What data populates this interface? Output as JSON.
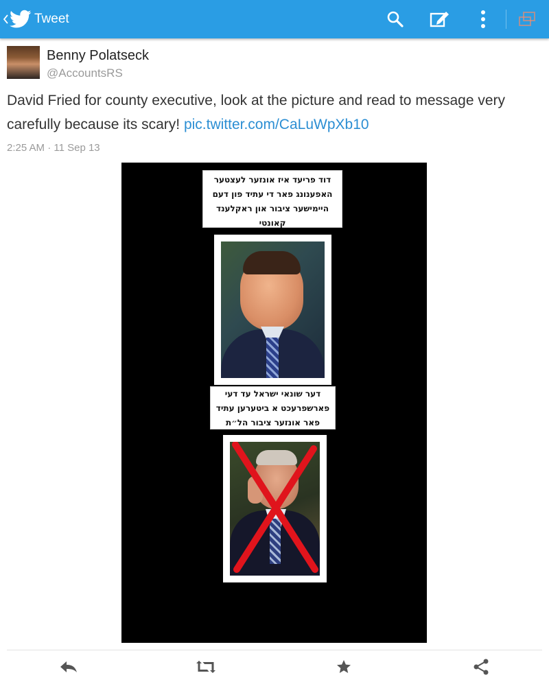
{
  "header": {
    "title": "Tweet",
    "icons": [
      "back-chevron-icon",
      "twitter-bird-icon",
      "search-icon",
      "compose-icon",
      "overflow-menu-icon",
      "recent-apps-icon"
    ],
    "color": "#2a9de4"
  },
  "tweet": {
    "author_name": "Benny Polatseck",
    "author_handle": "@AccountsRS",
    "text": "David Fried for county executive, look at the picture and read to message very carefully because its scary! ",
    "link_text": "pic.twitter.com/CaLuWpXb10",
    "timestamp": "2:25 AM · 11 Sep 13",
    "link_color": "#2b8ed3"
  },
  "media": {
    "caption_top_lines": [
      "דוד פריעד איז אונזער לעצטער",
      "האפענונג פאר די עתיד פון דעם",
      "היימישער ציבור און ראקלענד",
      "קאונטי"
    ],
    "caption_middle_lines": [
      "דער שונאי ישראל עד דעי",
      "פארשפרעכט א ביטערען עתיד",
      "פאר אונזער ציבור הל״ת"
    ],
    "photo_top": "smiling man in suit",
    "photo_bottom": "man with red X over photo"
  },
  "actions": {
    "icons": [
      "reply-icon",
      "retweet-icon",
      "favorite-star-icon",
      "share-icon"
    ]
  }
}
